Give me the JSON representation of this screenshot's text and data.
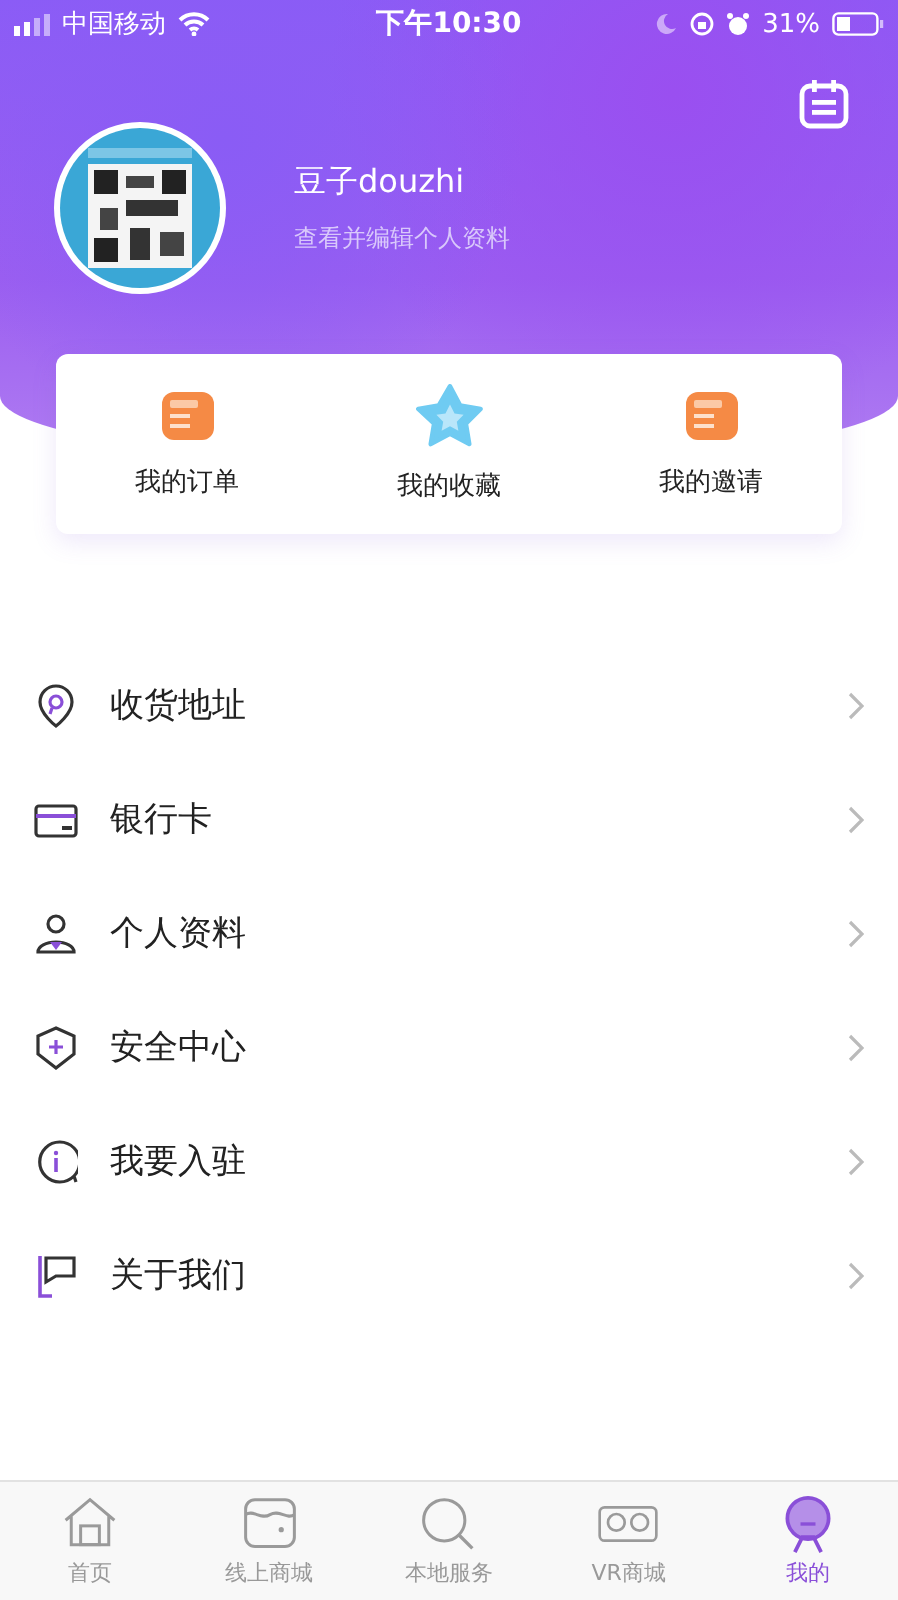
{
  "status_bar": {
    "carrier": "中国移动",
    "time": "下午10:30",
    "battery": "31%"
  },
  "profile": {
    "name": "豆子douzhi",
    "subtitle": "查看并编辑个人资料"
  },
  "quick_links": [
    {
      "kind": "order",
      "label": "我的订单"
    },
    {
      "kind": "favorite",
      "label": "我的收藏"
    },
    {
      "kind": "invite",
      "label": "我的邀请"
    }
  ],
  "menu": [
    {
      "kind": "location",
      "label": "收货地址"
    },
    {
      "kind": "card",
      "label": "银行卡"
    },
    {
      "kind": "person",
      "label": "个人资料"
    },
    {
      "kind": "shield",
      "label": "安全中心"
    },
    {
      "kind": "info",
      "label": "我要入驻"
    },
    {
      "kind": "flag",
      "label": "关于我们"
    }
  ],
  "tabs": [
    {
      "kind": "home",
      "label": "首页",
      "selected": false
    },
    {
      "kind": "shop",
      "label": "线上商城",
      "selected": false
    },
    {
      "kind": "search",
      "label": "本地服务",
      "selected": false
    },
    {
      "kind": "vr",
      "label": "VR商城",
      "selected": false
    },
    {
      "kind": "me",
      "label": "我的",
      "selected": true
    }
  ]
}
